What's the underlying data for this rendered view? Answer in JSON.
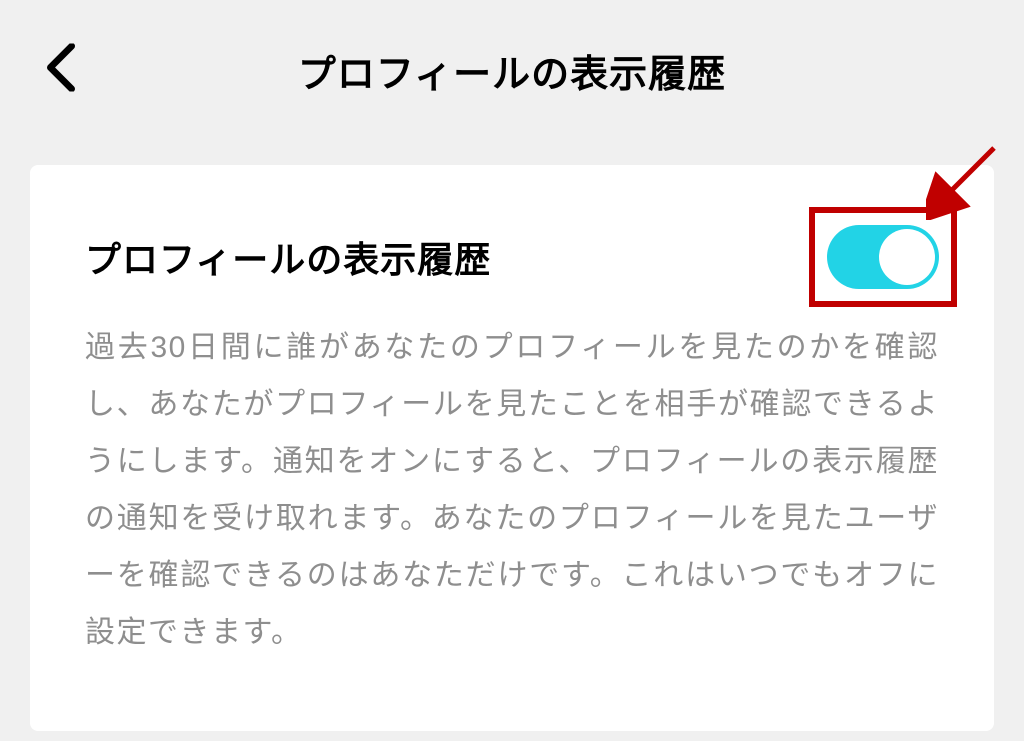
{
  "header": {
    "title": "プロフィールの表示履歴"
  },
  "setting": {
    "title": "プロフィールの表示履歴",
    "description": "過去30日間に誰があなたのプロフィールを見たのかを確認し、あなたがプロフィールを見たことを相手が確認できるようにします。通知をオンにすると、プロフィールの表示履歴の通知を受け取れます。あなたのプロフィールを見たユーザーを確認できるのはあなただけです。これはいつでもオフに設定できます。",
    "toggle_on": true
  },
  "annotation": {
    "highlight": "toggle",
    "arrow_color": "#c00000"
  }
}
